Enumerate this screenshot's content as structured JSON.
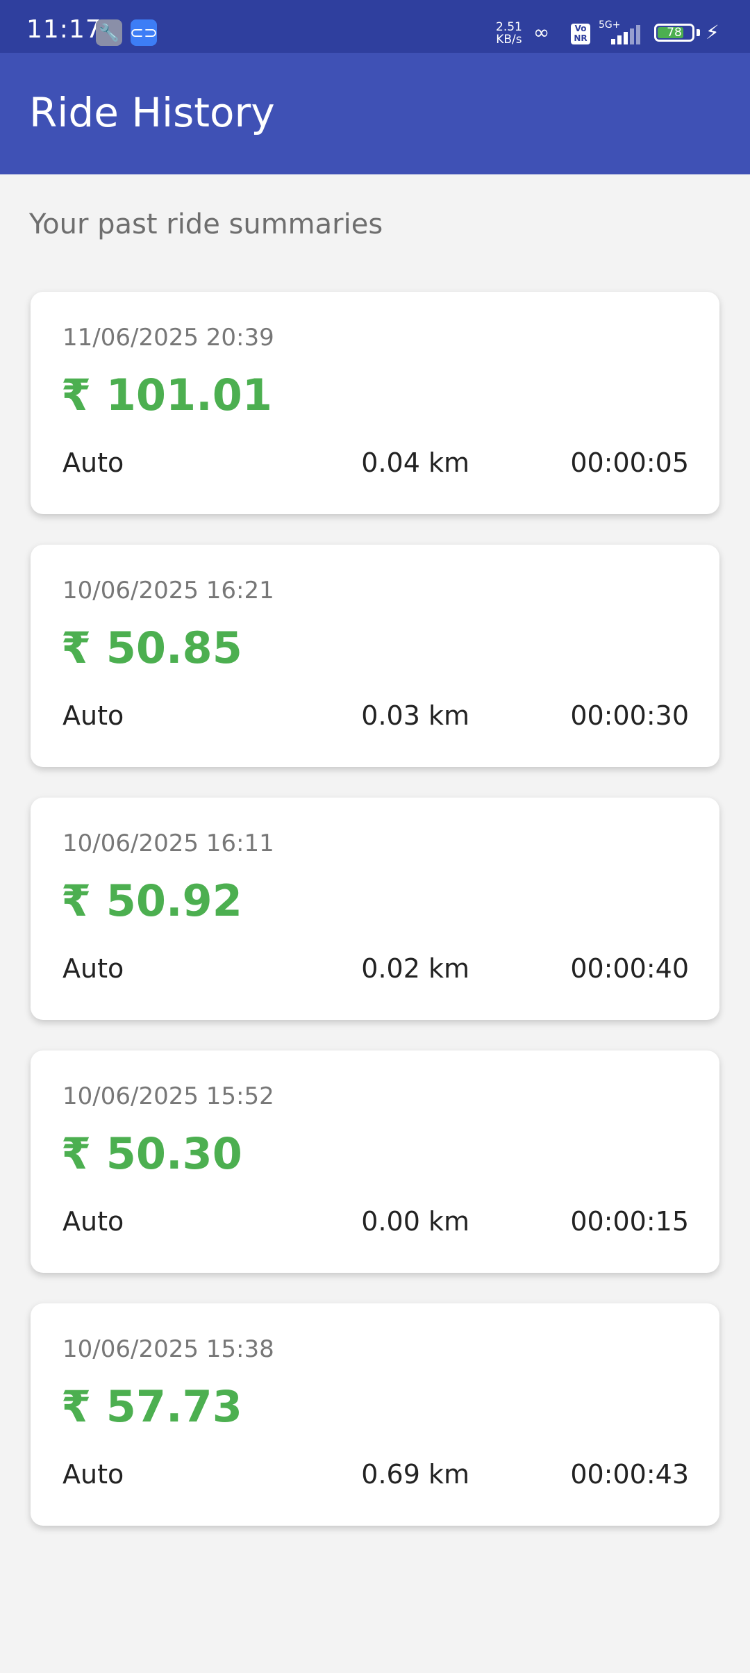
{
  "status_bar": {
    "time": "11:17",
    "net_speed_value": "2.51",
    "net_speed_unit": "KB/s",
    "volte_label": "Vo\nNR",
    "network_type": "5G+",
    "battery_level": "78",
    "battery_percent": 78,
    "icons": [
      "wrench-icon",
      "link-app-icon",
      "hotspot-icon",
      "volte-icon",
      "signal-icon",
      "battery-icon",
      "charging-icon"
    ]
  },
  "app_bar": {
    "title": "Ride History"
  },
  "subtitle": "Your past ride summaries",
  "rides": [
    {
      "date": "11/06/2025 20:39",
      "fare": "₹ 101.01",
      "mode": "Auto",
      "distance": "0.04 km",
      "duration": "00:00:05"
    },
    {
      "date": "10/06/2025 16:21",
      "fare": "₹ 50.85",
      "mode": "Auto",
      "distance": "0.03 km",
      "duration": "00:00:30"
    },
    {
      "date": "10/06/2025 16:11",
      "fare": "₹ 50.92",
      "mode": "Auto",
      "distance": "0.02 km",
      "duration": "00:00:40"
    },
    {
      "date": "10/06/2025 15:52",
      "fare": "₹ 50.30",
      "mode": "Auto",
      "distance": "0.00 km",
      "duration": "00:00:15"
    },
    {
      "date": "10/06/2025 15:38",
      "fare": "₹ 57.73",
      "mode": "Auto",
      "distance": "0.69 km",
      "duration": "00:00:43"
    }
  ],
  "colors": {
    "status_bar": "#2f3f9e",
    "app_bar": "#3f51b5",
    "fare_green": "#4caf50",
    "background": "#f3f3f3"
  }
}
